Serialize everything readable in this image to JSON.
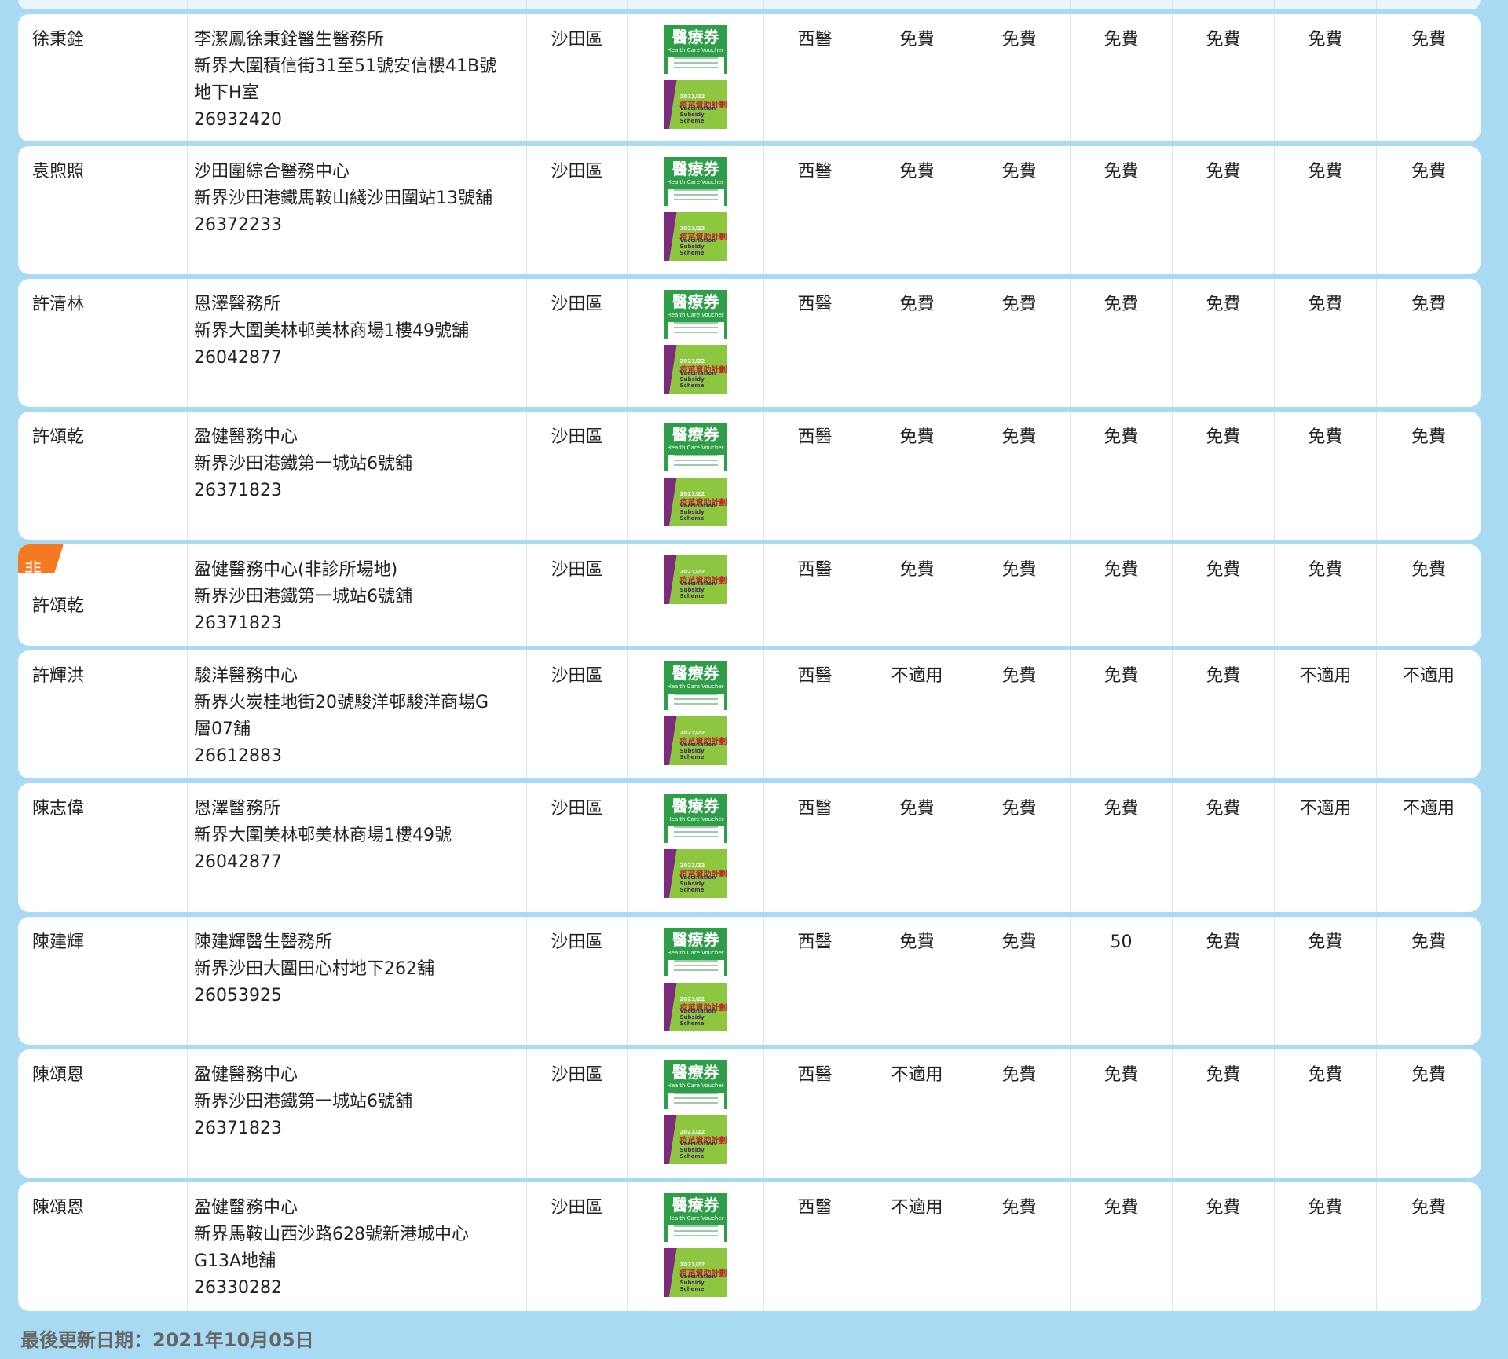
{
  "rows": [
    {
      "name": "徐秉銓",
      "clinic": [
        "李潔鳳徐秉銓醫生醫務所",
        "新界大圍積信街31至51號安信樓41B號",
        "地下H室",
        "26932420"
      ],
      "district": "沙田區",
      "hcv": true,
      "vss": true,
      "type": "西醫",
      "fees": [
        "免費",
        "免費",
        "免費",
        "免費",
        "免費",
        "免費"
      ],
      "height": 162
    },
    {
      "name": "袁煦照",
      "clinic": [
        "沙田圍綜合醫務中心",
        "新界沙田港鐵馬鞍山綫沙田圍站13號舖",
        "26372233"
      ],
      "district": "沙田區",
      "hcv": true,
      "vss": true,
      "type": "西醫",
      "fees": [
        "免費",
        "免費",
        "免費",
        "免費",
        "免費",
        "免費"
      ],
      "height": 163
    },
    {
      "name": "許清林",
      "clinic": [
        "恩澤醫務所",
        "新界大圍美林邨美林商場1樓49號舖",
        "26042877"
      ],
      "district": "沙田區",
      "hcv": true,
      "vss": true,
      "type": "西醫",
      "fees": [
        "免費",
        "免費",
        "免費",
        "免費",
        "免費",
        "免費"
      ],
      "height": 163
    },
    {
      "name": "許頌乾",
      "clinic": [
        "盈健醫務中心",
        "新界沙田港鐵第一城站6號舖",
        "26371823"
      ],
      "district": "沙田區",
      "hcv": true,
      "vss": true,
      "type": "西醫",
      "fees": [
        "免費",
        "免費",
        "免費",
        "免費",
        "免費",
        "免費"
      ],
      "height": 163
    },
    {
      "name": "許頌乾",
      "tag": "非診所場地",
      "clinic": [
        "盈健醫務中心(非診所場地)",
        "新界沙田港鐵第一城站6號舖",
        "26371823"
      ],
      "district": "沙田區",
      "hcv": false,
      "vss": true,
      "type": "西醫",
      "fees": [
        "免費",
        "免費",
        "免費",
        "免費",
        "免費",
        "免費"
      ],
      "height": 129
    },
    {
      "name": "許輝洪",
      "clinic": [
        "駿洋醫務中心",
        "新界火炭桂地街20號駿洋邨駿洋商場G",
        "層07舖",
        "26612883"
      ],
      "district": "沙田區",
      "hcv": true,
      "vss": true,
      "type": "西醫",
      "fees": [
        "不適用",
        "免費",
        "免費",
        "免費",
        "不適用",
        "不適用"
      ],
      "height": 163
    },
    {
      "name": "陳志偉",
      "clinic": [
        "恩澤醫務所",
        "新界大圍美林邨美林商場1樓49號",
        "26042877"
      ],
      "district": "沙田區",
      "hcv": true,
      "vss": true,
      "type": "西醫",
      "fees": [
        "免費",
        "免費",
        "免費",
        "免費",
        "不適用",
        "不適用"
      ],
      "height": 164
    },
    {
      "name": "陳建輝",
      "clinic": [
        "陳建輝醫生醫務所",
        "新界沙田大圍田心村地下262舖",
        "26053925"
      ],
      "district": "沙田區",
      "hcv": true,
      "vss": true,
      "type": "西醫",
      "fees": [
        "免費",
        "免費",
        "50",
        "免費",
        "免費",
        "免費"
      ],
      "height": 163
    },
    {
      "name": "陳頌恩",
      "clinic": [
        "盈健醫務中心",
        "新界沙田港鐵第一城站6號舖",
        "26371823"
      ],
      "district": "沙田區",
      "hcv": true,
      "vss": true,
      "type": "西醫",
      "fees": [
        "不適用",
        "免費",
        "免費",
        "免費",
        "免費",
        "免費"
      ],
      "height": 163
    },
    {
      "name": "陳頌恩",
      "clinic": [
        "盈健醫務中心",
        "新界馬鞍山西沙路628號新港城中心",
        "G13A地舖",
        "26330282"
      ],
      "district": "沙田區",
      "hcv": true,
      "vss": true,
      "type": "西醫",
      "fees": [
        "不適用",
        "免費",
        "免費",
        "免費",
        "免費",
        "免費"
      ],
      "height": 164
    }
  ],
  "badges": {
    "hcv_title": "醫療券",
    "hcv_sub": "Health Care Voucher",
    "vss_year": "2021/22",
    "vss_title": "疫苗資助計劃",
    "vss_sub": "Vaccination Subsidy Scheme"
  },
  "footer": {
    "last_updated": "最後更新日期：2021年10月05日"
  }
}
